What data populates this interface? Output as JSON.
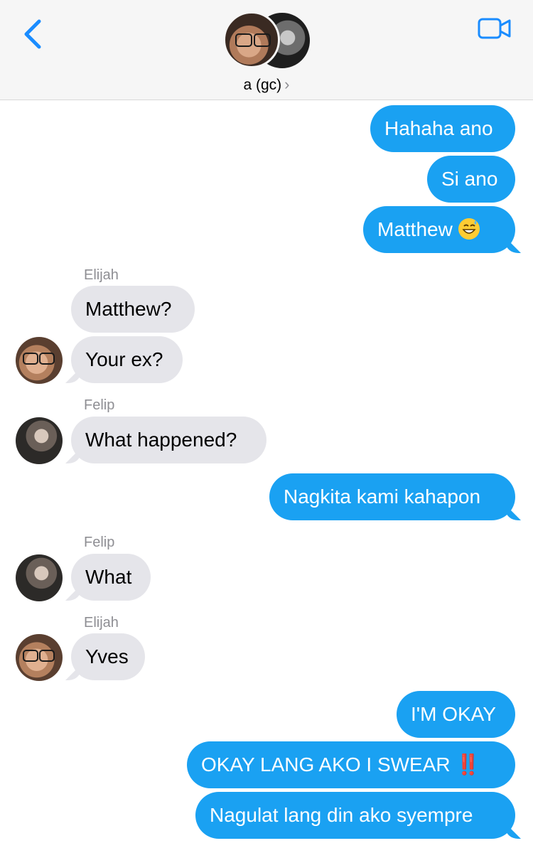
{
  "header": {
    "group_name": "a (gc)",
    "chevron": "›",
    "back_icon": "chevron-left-icon",
    "video_icon": "video-camera-icon",
    "accent": "#1aa1f2"
  },
  "messages": [
    {
      "from": "me",
      "text": "Hahaha ano"
    },
    {
      "from": "me",
      "text": "Si ano"
    },
    {
      "from": "me",
      "text": "Matthew",
      "emoji": "grinning-sweat-emoji"
    },
    {
      "from": "Elijah",
      "sender_label": "Elijah",
      "text": "Matthew?"
    },
    {
      "from": "Elijah",
      "text": "Your ex?"
    },
    {
      "from": "Felip",
      "sender_label": "Felip",
      "text": "What happened?"
    },
    {
      "from": "me",
      "text": "Nagkita kami kahapon"
    },
    {
      "from": "Felip",
      "sender_label": "Felip",
      "text": "What"
    },
    {
      "from": "Elijah",
      "sender_label": "Elijah",
      "text": "Yves"
    },
    {
      "from": "me",
      "text": "I'M OKAY"
    },
    {
      "from": "me",
      "text": "OKAY LANG AKO I SWEAR",
      "emoji": "double-exclamation-emoji",
      "emoji_text": "‼️"
    },
    {
      "from": "me",
      "text": "Nagulat lang din ako syempre"
    }
  ],
  "colors": {
    "outgoing": "#1aa1f2",
    "incoming": "#e5e5ea",
    "sender_label": "#8e8e93"
  }
}
